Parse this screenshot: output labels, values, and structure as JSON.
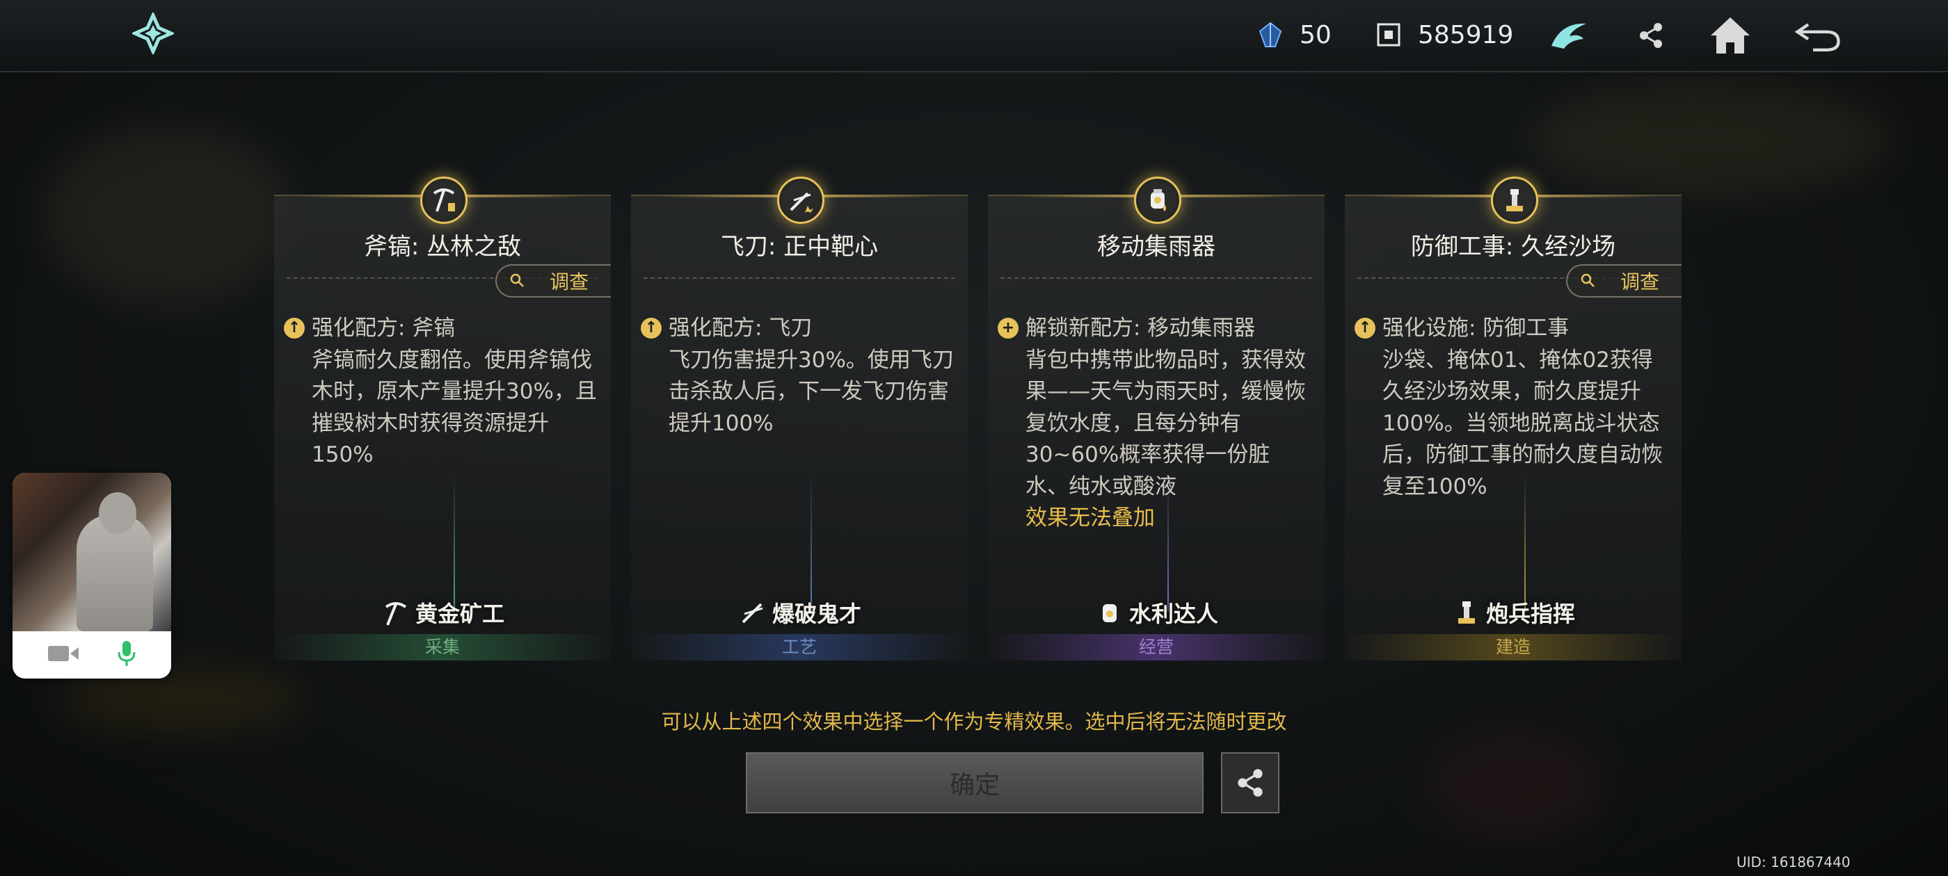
{
  "topbar": {
    "crystal_count": "50",
    "coin_count": "585919"
  },
  "cards": [
    {
      "title": "斧镐: 丛林之敌",
      "investigate_label": "调查",
      "has_investigate": true,
      "heading": "强化配方: 斧镐",
      "desc": "斧镐耐久度翻倍。使用斧镐伐木时，原木产量提升30%，且摧毁树木时获得资源提升150%",
      "note": "",
      "badge": "黄金矿工",
      "category": "采集",
      "accent": "#3e8a5a"
    },
    {
      "title": "飞刀: 正中靶心",
      "investigate_label": "",
      "has_investigate": false,
      "heading": "强化配方: 飞刀",
      "desc": "飞刀伤害提升30%。使用飞刀击杀敌人后，下一发飞刀伤害提升100%",
      "note": "",
      "badge": "爆破鬼才",
      "category": "工艺",
      "accent": "#3f5f8e"
    },
    {
      "title": "移动集雨器",
      "investigate_label": "",
      "has_investigate": false,
      "heading": "解锁新配方: 移动集雨器",
      "desc": "背包中携带此物品时，获得效果——天气为雨天时，缓慢恢复饮水度，且每分钟有30~60%概率获得一份脏水、纯水或酸液",
      "note": "效果无法叠加",
      "badge": "水利达人",
      "category": "经营",
      "accent": "#6a4f9a"
    },
    {
      "title": "防御工事: 久经沙场",
      "investigate_label": "调查",
      "has_investigate": true,
      "heading": "强化设施: 防御工事",
      "desc": "沙袋、掩体01、掩体02获得久经沙场效果，耐久度提升100%。当领地脱离战斗状态后，防御工事的耐久度自动恢复至100%",
      "note": "",
      "badge": "炮兵指挥",
      "category": "建造",
      "accent": "#8a7430"
    }
  ],
  "hint": "可以从上述四个效果中选择一个作为专精效果。选中后将无法随时更改",
  "confirm_label": "确定",
  "uid": "UID: 161867440"
}
